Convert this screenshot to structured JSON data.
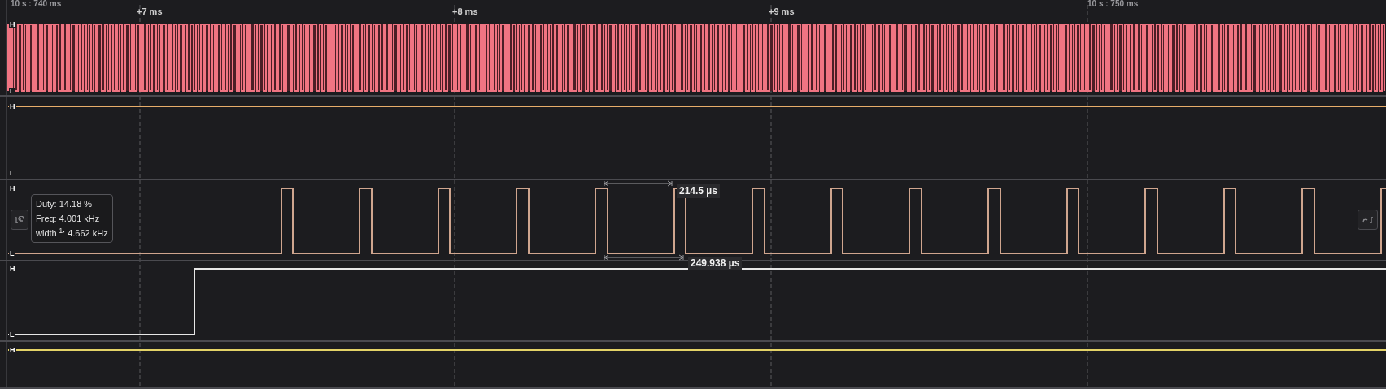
{
  "ruler": {
    "labels": [
      {
        "text": "10 s : 740 ms",
        "kind": "absolute"
      },
      {
        "text": "+7 ms",
        "kind": "relative"
      },
      {
        "text": "+8 ms",
        "kind": "relative"
      },
      {
        "text": "+9 ms",
        "kind": "relative"
      },
      {
        "text": "10 s : 750 ms",
        "kind": "absolute"
      }
    ]
  },
  "channels": [
    {
      "kind": "pwm-burst",
      "color": "#f07482",
      "high_label": "H",
      "low_label": "L"
    },
    {
      "kind": "constant-high",
      "color": "#e7ad6a",
      "high_label": "H",
      "low_label": "L"
    },
    {
      "kind": "pulse-train",
      "color": "#cfa58e",
      "high_label": "H",
      "low_label": "L"
    },
    {
      "kind": "step",
      "color": "#e6e6e6",
      "high_label": "H",
      "low_label": "L"
    },
    {
      "kind": "constant-high",
      "color": "#e3d267",
      "high_label": "H"
    }
  ],
  "tooltip": {
    "lines": [
      "Duty: 14.18 %",
      "Freq: 4.001 kHz",
      "width$^{-1}$: 4.662 kHz"
    ]
  },
  "measurements": [
    {
      "label": "214.5 µs"
    },
    {
      "label": "249.938 µs"
    }
  ]
}
